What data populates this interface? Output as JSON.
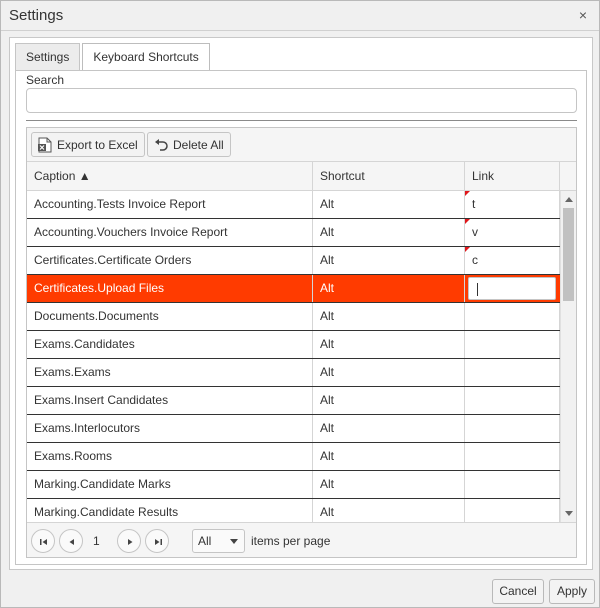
{
  "window": {
    "title": "Settings",
    "close_label": "×"
  },
  "tabs": [
    {
      "label": "Settings",
      "active": false
    },
    {
      "label": "Keyboard Shortcuts",
      "active": true
    }
  ],
  "search": {
    "label": "Search",
    "value": "",
    "placeholder": ""
  },
  "toolbar": {
    "export_label": "Export to Excel",
    "delete_label": "Delete All"
  },
  "columns": {
    "caption": "Caption ▲",
    "shortcut": "Shortcut",
    "link": "Link"
  },
  "rows": [
    {
      "caption": "Accounting.Tests Invoice Report",
      "shortcut": "Alt",
      "link": "t"
    },
    {
      "caption": "Accounting.Vouchers Invoice Report",
      "shortcut": "Alt",
      "link": "v"
    },
    {
      "caption": "Certificates.Certificate Orders",
      "shortcut": "Alt",
      "link": "c"
    },
    {
      "caption": "Certificates.Upload Files",
      "shortcut": "Alt",
      "link": ""
    },
    {
      "caption": "Documents.Documents",
      "shortcut": "Alt",
      "link": ""
    },
    {
      "caption": "Exams.Candidates",
      "shortcut": "Alt",
      "link": ""
    },
    {
      "caption": "Exams.Exams",
      "shortcut": "Alt",
      "link": ""
    },
    {
      "caption": "Exams.Insert Candidates",
      "shortcut": "Alt",
      "link": ""
    },
    {
      "caption": "Exams.Interlocutors",
      "shortcut": "Alt",
      "link": ""
    },
    {
      "caption": "Exams.Rooms",
      "shortcut": "Alt",
      "link": ""
    },
    {
      "caption": "Marking.Candidate Marks",
      "shortcut": "Alt",
      "link": ""
    },
    {
      "caption": "Marking.Candidate Results",
      "shortcut": "Alt",
      "link": ""
    }
  ],
  "selected_row": "Certificates.Upload Files",
  "pager": {
    "page": "1",
    "page_size": "All",
    "items_label": "items per page"
  },
  "footer": {
    "cancel_label": "Cancel",
    "apply_label": "Apply"
  },
  "colors": {
    "selected_row": "#ff3b00",
    "dirty_marker": "#e0161b"
  }
}
